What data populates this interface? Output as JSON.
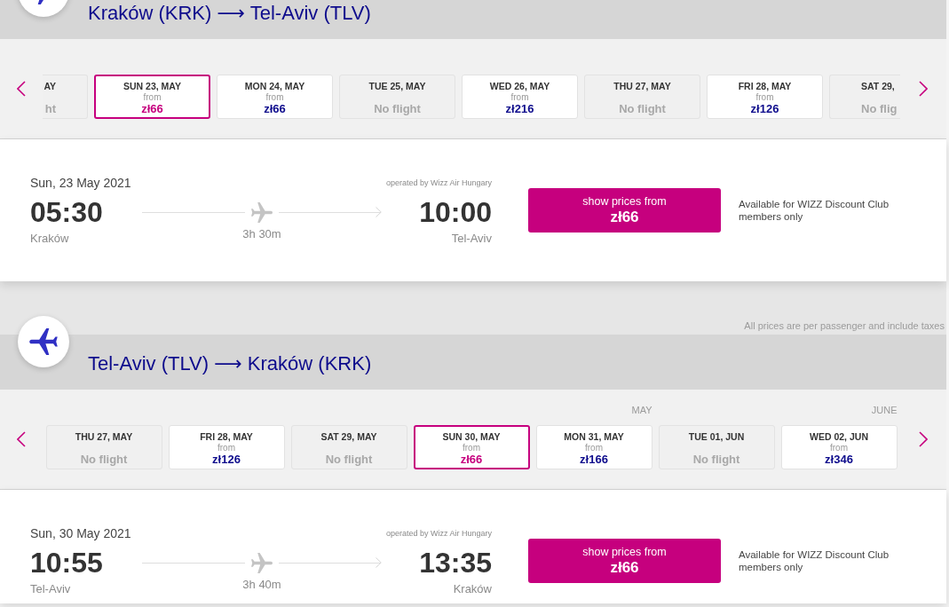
{
  "outbound": {
    "route": "Kraków (KRK) ⟶ Tel-Aviv (TLV)",
    "days": [
      {
        "day": "AY",
        "kind": "no-flight",
        "status": "ht",
        "cut_left": true,
        "selected": false
      },
      {
        "day": "SUN 23, MAY",
        "kind": "flight",
        "from": "from",
        "price": "zł66",
        "selected": true
      },
      {
        "day": "MON 24, MAY",
        "kind": "flight",
        "from": "from",
        "price": "zł66",
        "selected": false
      },
      {
        "day": "TUE 25, MAY",
        "kind": "no-flight",
        "status": "No flight",
        "selected": false
      },
      {
        "day": "WED 26, MAY",
        "kind": "flight",
        "from": "from",
        "price": "zł216",
        "selected": false
      },
      {
        "day": "THU 27, MAY",
        "kind": "no-flight",
        "status": "No flight",
        "selected": false
      },
      {
        "day": "FRI 28, MAY",
        "kind": "flight",
        "from": "from",
        "price": "zł126",
        "selected": false
      },
      {
        "day": "SAT 29,",
        "kind": "no-flight",
        "status": "No flig",
        "cut_right": true,
        "selected": false
      }
    ],
    "flight": {
      "date": "Sun, 23 May 2021",
      "operator": "operated by Wizz Air Hungary",
      "departure_time": "05:30",
      "arrival_time": "10:00",
      "departure_city": "Kraków",
      "duration": "3h 30m",
      "arrival_city": "Tel-Aviv",
      "price_button": {
        "label": "show prices from",
        "price": "zł66"
      },
      "note": "Available for WIZZ Discount Club members only"
    }
  },
  "price_note": "All prices are per passenger and include taxes",
  "return": {
    "route": "Tel-Aviv (TLV) ⟶ Kraków (KRK)",
    "days": [
      {
        "day": "THU 27, MAY",
        "kind": "no-flight",
        "status": "No flight",
        "selected": false
      },
      {
        "day": "FRI 28, MAY",
        "kind": "flight",
        "from": "from",
        "price": "zł126",
        "selected": false
      },
      {
        "day": "SAT 29, MAY",
        "kind": "no-flight",
        "status": "No flight",
        "selected": false
      },
      {
        "day": "SUN 30, MAY",
        "kind": "flight",
        "from": "from",
        "price": "zł66",
        "selected": true
      },
      {
        "day": "MON 31, MAY",
        "month": "MAY",
        "kind": "flight",
        "from": "from",
        "price": "zł166",
        "selected": false
      },
      {
        "day": "TUE 01, JUN",
        "kind": "no-flight",
        "status": "No flight",
        "selected": false
      },
      {
        "day": "WED 02, JUN",
        "month": "JUNE",
        "kind": "flight",
        "from": "from",
        "price": "zł346",
        "selected": false
      }
    ],
    "flight": {
      "date": "Sun, 30 May 2021",
      "operator": "operated by Wizz Air Hungary",
      "departure_time": "10:55",
      "arrival_time": "13:35",
      "departure_city": "Tel-Aviv",
      "duration": "3h 40m",
      "arrival_city": "Kraków",
      "price_button": {
        "label": "show prices from",
        "price": "zł66"
      },
      "note": "Available for WIZZ Discount Club members only"
    }
  }
}
